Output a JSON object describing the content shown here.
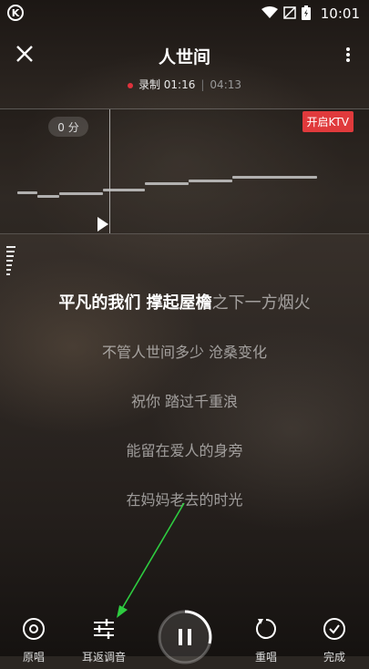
{
  "status_bar": {
    "app_badge": "K",
    "time": "10:01"
  },
  "header": {
    "title": "人世间"
  },
  "recording": {
    "label": "录制 01:16",
    "separator": "|",
    "total": "04:13"
  },
  "pitch_panel": {
    "score": "0 分",
    "ktv_button": "开启KTV"
  },
  "lyrics": {
    "current_sung": "平凡的我们 撑起屋檐",
    "current_unsung": "之下一方烟火",
    "upcoming": [
      "不管人世间多少 沧桑变化",
      "祝你 踏过千重浪",
      "能留在爱人的身旁",
      "在妈妈老去的时光"
    ]
  },
  "controls": {
    "original": "原唱",
    "ear_return": "耳返调音",
    "restart": "重唱",
    "finish": "完成"
  },
  "colors": {
    "accent_red": "#e0323c",
    "annotation_arrow": "#2ecc40"
  },
  "icons": [
    "close-icon",
    "more-icon",
    "record-dot-icon",
    "play-icon",
    "volume-bars-icon",
    "original-vocal-icon",
    "equalizer-icon",
    "pause-icon",
    "restart-icon",
    "check-icon"
  ]
}
